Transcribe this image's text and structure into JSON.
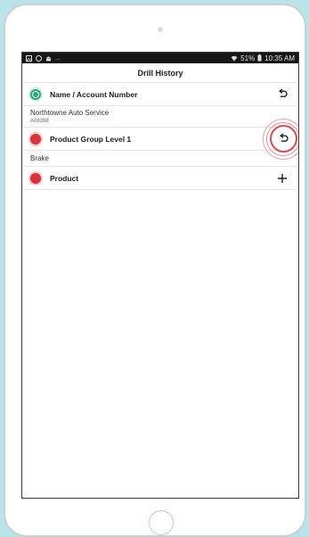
{
  "status_bar": {
    "left_icons": [
      "gallery-icon",
      "messenger-icon",
      "android-icon"
    ],
    "dots": "...",
    "wifi": "wifi-icon",
    "battery_percent": "51%",
    "battery_icon": "battery-icon",
    "time": "10:35 AM"
  },
  "header": {
    "title": "Drill History"
  },
  "levels": [
    {
      "label": "Name / Account Number",
      "status": "green",
      "action_icon": "undo-icon"
    },
    {
      "label": "Product Group Level 1",
      "status": "red",
      "action_icon": "undo-icon",
      "highlighted": true
    },
    {
      "label": "Product",
      "status": "red",
      "action_icon": "plus-icon"
    }
  ],
  "values": {
    "account_name": "Northtowne Auto Service",
    "account_number": "A08398",
    "product_group": "Brake"
  },
  "colors": {
    "green": "#2aa877",
    "red": "#d8323a",
    "highlight_ring": "#e14b50",
    "background": "#b9e4e9"
  }
}
